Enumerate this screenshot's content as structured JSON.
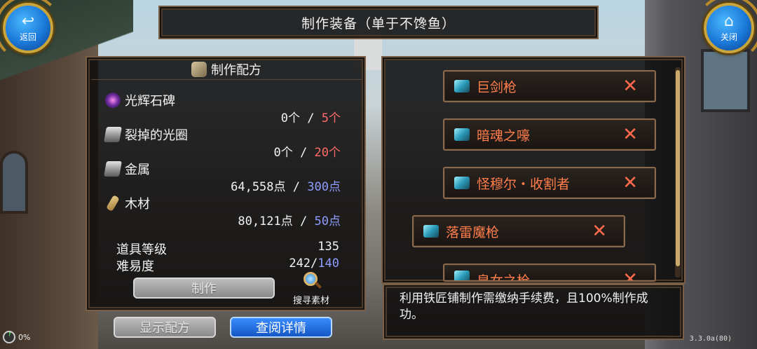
{
  "header": {
    "title": "制作装备（单于不馋鱼）",
    "back_label": "返回",
    "close_label": "关闭"
  },
  "recipe": {
    "header": "制作配方",
    "materials": [
      {
        "name": "光辉石碑",
        "icon": "orb-icon",
        "have": "0个",
        "sep": "/",
        "need": "5个",
        "need_color": "#ff6a6a"
      },
      {
        "name": "裂掉的光圈",
        "icon": "ingot-icon",
        "have": "0个",
        "sep": "/",
        "need": "20个",
        "need_color": "#ff6a6a"
      },
      {
        "name": "金属",
        "icon": "ingot-icon",
        "have": "64,558点",
        "sep": "/",
        "need": "300点",
        "need_color": "#8f9cff"
      },
      {
        "name": "木材",
        "icon": "wood-icon",
        "have": "80,121点",
        "sep": "/",
        "need": "50点",
        "need_color": "#8f9cff"
      }
    ],
    "item_level_label": "道具等级",
    "item_level_value": "135",
    "difficulty_label": "难易度",
    "difficulty_current": "242/",
    "difficulty_max": "140",
    "craft_label": "制作",
    "search_label": "搜寻素材",
    "show_recipe_label": "显示配方",
    "view_details_label": "查阅详情"
  },
  "equipment": {
    "items": [
      {
        "name": "巨剑枪"
      },
      {
        "name": "暗魂之嚎"
      },
      {
        "name": "怪穆尔・收割者"
      },
      {
        "name": "落雷魔枪"
      },
      {
        "name": "皇女之枪"
      }
    ],
    "remove_glyph": "✕"
  },
  "info": {
    "text": "利用铁匠铺制作需缴纳手续费，且100%制作成功。"
  },
  "status": {
    "progress": "0%",
    "version": "3.3.0a(80)"
  },
  "colors": {
    "accent_red": "#ff6a6a",
    "accent_blue": "#8f9cff",
    "item_orange": "#ff7d4a",
    "panel_border": "#7a5f48"
  }
}
